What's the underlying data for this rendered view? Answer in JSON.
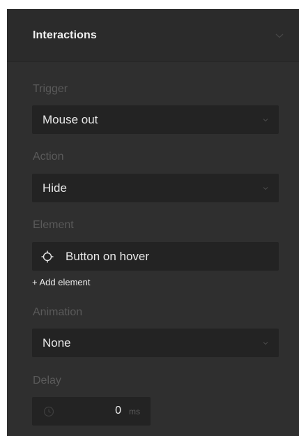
{
  "panel": {
    "title": "Interactions"
  },
  "trigger": {
    "label": "Trigger",
    "value": "Mouse out"
  },
  "action": {
    "label": "Action",
    "value": "Hide"
  },
  "element": {
    "label": "Element",
    "value": "Button on hover",
    "add_label": "+ Add element"
  },
  "animation": {
    "label": "Animation",
    "value": "None"
  },
  "delay": {
    "label": "Delay",
    "value": "0",
    "unit": "ms"
  },
  "icons": {
    "header_chevron": "chevron-down-icon",
    "select_chevron": "chevron-down-icon",
    "element_target": "target-icon",
    "delay_clock": "clock-icon"
  },
  "colors": {
    "panel_bg": "#2f2f2f",
    "header_bg": "#2b2b2b",
    "field_bg": "#232323",
    "label_text": "#5a5a5a",
    "value_text": "#e8e8e8"
  }
}
